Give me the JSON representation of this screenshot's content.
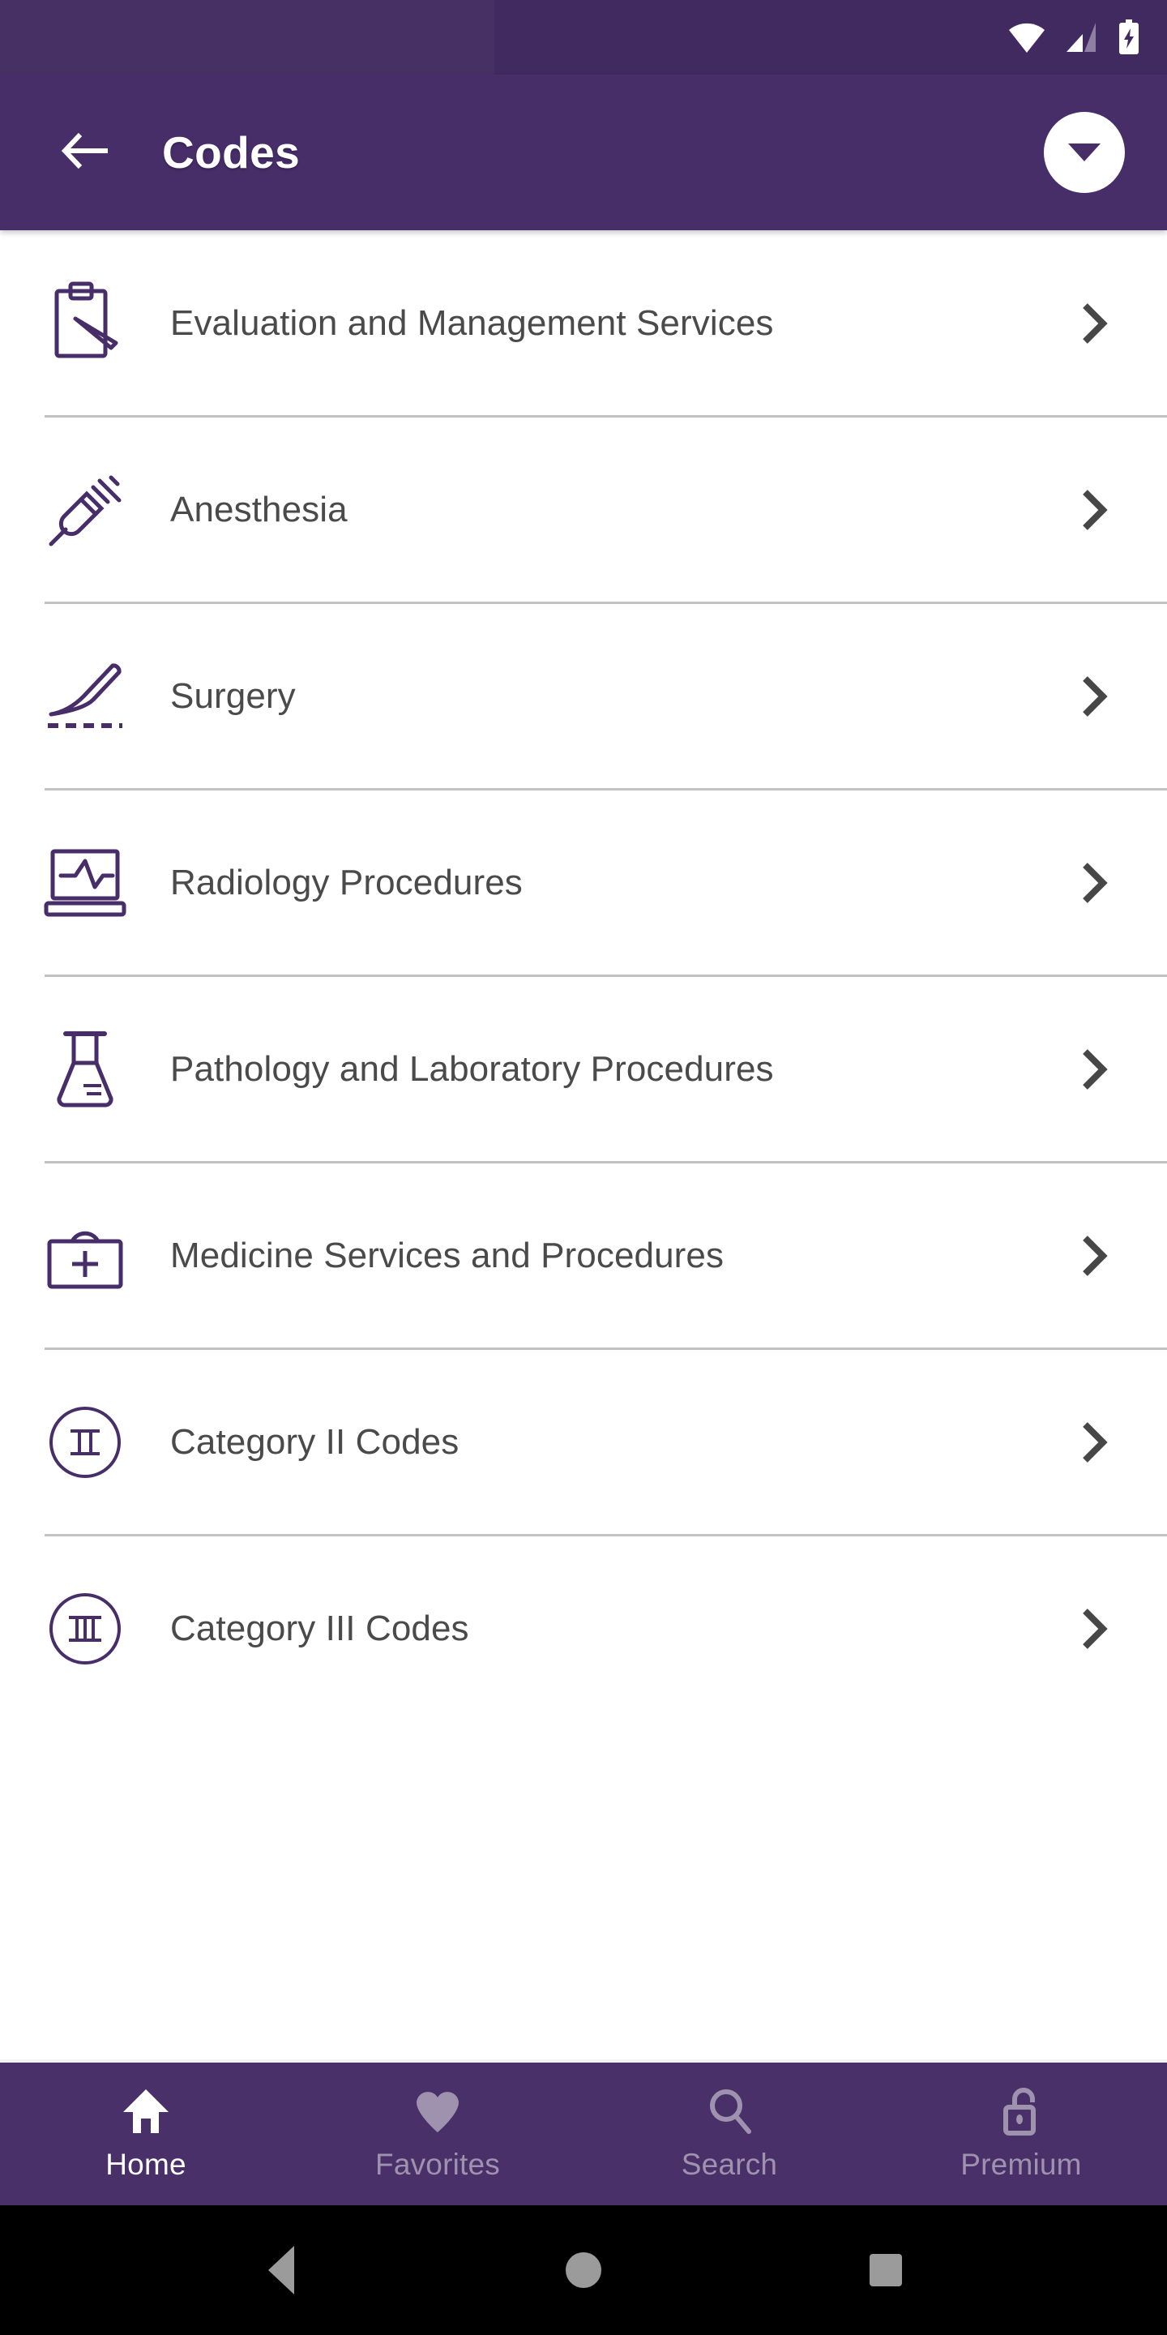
{
  "status_bar": {
    "icons": [
      "wifi-icon",
      "cellular-signal-icon",
      "battery-charging-icon"
    ]
  },
  "app_bar": {
    "back_icon": "arrow-left-icon",
    "title": "Codes",
    "dropdown_icon": "chevron-down-icon"
  },
  "colors": {
    "primary_purple": "#472E69",
    "status_bar_purple": "#412A5F",
    "bottom_nav_purple": "#4A3069",
    "icon_outline": "#472E69",
    "row_text": "#4a4a4a",
    "divider": "#c2c2c2",
    "nav_inactive": "#9F92AE",
    "nav_active": "#FFFFFF",
    "chevron": "#474747"
  },
  "list": {
    "items": [
      {
        "label": "Evaluation and Management Services",
        "icon": "clipboard-pen-icon",
        "chevron": "chevron-right-icon"
      },
      {
        "label": "Anesthesia",
        "icon": "syringe-icon",
        "chevron": "chevron-right-icon"
      },
      {
        "label": "Surgery",
        "icon": "scalpel-icon",
        "chevron": "chevron-right-icon"
      },
      {
        "label": "Radiology Procedures",
        "icon": "monitor-waveform-icon",
        "chevron": "chevron-right-icon"
      },
      {
        "label": "Pathology and Laboratory Procedures",
        "icon": "flask-icon",
        "chevron": "chevron-right-icon"
      },
      {
        "label": "Medicine Services and Procedures",
        "icon": "medical-bag-icon",
        "chevron": "chevron-right-icon"
      },
      {
        "label": "Category II Codes",
        "icon": "circle-numeral-two-icon",
        "numeral": "Ⅱ",
        "chevron": "chevron-right-icon"
      },
      {
        "label": "Category III Codes",
        "icon": "circle-numeral-three-icon",
        "numeral": "Ⅲ",
        "chevron": "chevron-right-icon"
      }
    ]
  },
  "bottom_nav": {
    "items": [
      {
        "label": "Home",
        "icon": "home-icon",
        "active": true
      },
      {
        "label": "Favorites",
        "icon": "heart-icon",
        "active": false
      },
      {
        "label": "Search",
        "icon": "search-icon",
        "active": false
      },
      {
        "label": "Premium",
        "icon": "unlock-icon",
        "active": false
      }
    ]
  },
  "system_nav": {
    "back": "triangle-back-icon",
    "home": "circle-home-icon",
    "recents": "square-recents-icon"
  }
}
